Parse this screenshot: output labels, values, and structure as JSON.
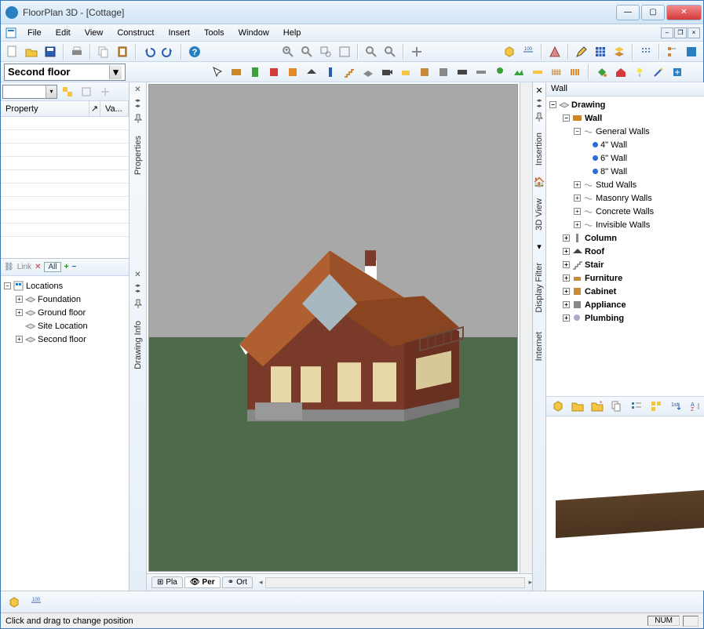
{
  "title": "FloorPlan 3D - [Cottage]",
  "menus": [
    "File",
    "Edit",
    "View",
    "Construct",
    "Insert",
    "Tools",
    "Window",
    "Help"
  ],
  "floor_selected": "Second floor",
  "property_panel": {
    "col_property": "Property",
    "col_value": "Va..."
  },
  "left_tabs": [
    "Properties",
    "Drawing Info"
  ],
  "locations_tools": {
    "link": "Link",
    "all": "All"
  },
  "locations": {
    "root": "Locations",
    "items": [
      "Foundation",
      "Ground floor",
      "Site Location",
      "Second floor"
    ]
  },
  "view_tabs": [
    "Pla",
    "Per",
    "Ort"
  ],
  "right_tabs": [
    "Insertion",
    "3D View",
    "Display Filter",
    "Internet"
  ],
  "library_title": "Wall",
  "library": {
    "root": "Drawing",
    "wall": "Wall",
    "general": "General Walls",
    "sizes": [
      "4\" Wall",
      "6\" Wall",
      "8\" Wall"
    ],
    "wall_groups": [
      "Stud Walls",
      "Masonry Walls",
      "Concrete Walls",
      "Invisible Walls"
    ],
    "categories": [
      "Column",
      "Roof",
      "Stair",
      "Furniture",
      "Cabinet",
      "Appliance",
      "Plumbing"
    ]
  },
  "status": {
    "text": "Click and drag to change position",
    "num": "NUM"
  }
}
